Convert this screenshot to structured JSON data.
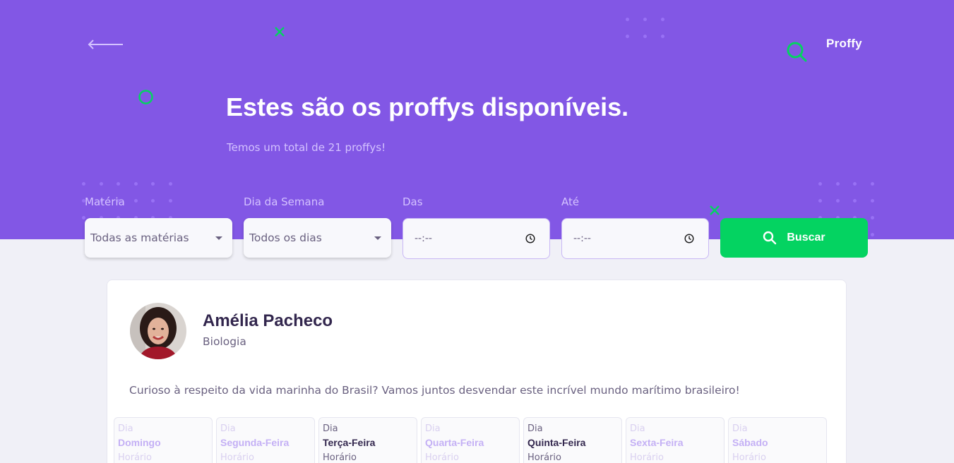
{
  "app": {
    "logo": "Proffy"
  },
  "hero": {
    "title": "Estes são os proffys disponíveis.",
    "subtitle": "Temos um total de 21 proffys!"
  },
  "filters": {
    "subject": {
      "label": "Matéria",
      "value": "Todas as matérias"
    },
    "weekday": {
      "label": "Dia da Semana",
      "value": "Todos os dias"
    },
    "from": {
      "label": "Das",
      "value": "--:--"
    },
    "to": {
      "label": "Até",
      "value": "--:--"
    },
    "search_label": "Buscar"
  },
  "teacher": {
    "name": "Amélia Pacheco",
    "subject": "Biologia",
    "bio": "Curioso à respeito da vida marinha do Brasil? Vamos juntos desvendar este incrível mundo marítimo brasileiro!"
  },
  "schedule": [
    {
      "day_label": "Dia",
      "day": "Domingo",
      "time_label": "Horário",
      "active": false
    },
    {
      "day_label": "Dia",
      "day": "Segunda-Feira",
      "time_label": "Horário",
      "active": false
    },
    {
      "day_label": "Dia",
      "day": "Terça-Feira",
      "time_label": "Horário",
      "active": true
    },
    {
      "day_label": "Dia",
      "day": "Quarta-Feira",
      "time_label": "Horário",
      "active": false
    },
    {
      "day_label": "Dia",
      "day": "Quinta-Feira",
      "time_label": "Horário",
      "active": true
    },
    {
      "day_label": "Dia",
      "day": "Sexta-Feira",
      "time_label": "Horário",
      "active": false
    },
    {
      "day_label": "Dia",
      "day": "Sábado",
      "time_label": "Horário",
      "active": false
    }
  ],
  "colors": {
    "primary": "#8257e5",
    "secondary": "#04d361",
    "background": "#f0f0f7",
    "title_text": "#32264d",
    "body_text": "#6a6180"
  },
  "icons": [
    "back-arrow-icon",
    "search-icon",
    "caret-down-icon",
    "clock-icon",
    "logo-search-icon"
  ]
}
